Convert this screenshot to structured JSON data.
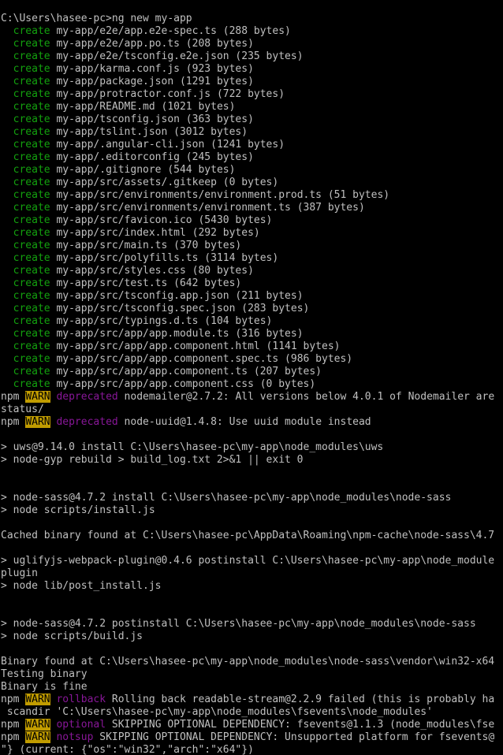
{
  "colors": {
    "background": "#000000",
    "foreground": "#c0c0c0",
    "create_green": "#13a10e",
    "warn_background": "#c19c00",
    "warn_text": "#000000",
    "magenta": "#881798"
  },
  "lines": [
    [
      {
        "t": "C:\\Users\\hasee-pc>ng new my-app",
        "c": "gray"
      }
    ],
    [
      {
        "t": "  create",
        "c": "green"
      },
      {
        "t": " my-app/e2e/app.e2e-spec.ts (288 bytes)",
        "c": "gray"
      }
    ],
    [
      {
        "t": "  create",
        "c": "green"
      },
      {
        "t": " my-app/e2e/app.po.ts (208 bytes)",
        "c": "gray"
      }
    ],
    [
      {
        "t": "  create",
        "c": "green"
      },
      {
        "t": " my-app/e2e/tsconfig.e2e.json (235 bytes)",
        "c": "gray"
      }
    ],
    [
      {
        "t": "  create",
        "c": "green"
      },
      {
        "t": " my-app/karma.conf.js (923 bytes)",
        "c": "gray"
      }
    ],
    [
      {
        "t": "  create",
        "c": "green"
      },
      {
        "t": " my-app/package.json (1291 bytes)",
        "c": "gray"
      }
    ],
    [
      {
        "t": "  create",
        "c": "green"
      },
      {
        "t": " my-app/protractor.conf.js (722 bytes)",
        "c": "gray"
      }
    ],
    [
      {
        "t": "  create",
        "c": "green"
      },
      {
        "t": " my-app/README.md (1021 bytes)",
        "c": "gray"
      }
    ],
    [
      {
        "t": "  create",
        "c": "green"
      },
      {
        "t": " my-app/tsconfig.json (363 bytes)",
        "c": "gray"
      }
    ],
    [
      {
        "t": "  create",
        "c": "green"
      },
      {
        "t": " my-app/tslint.json (3012 bytes)",
        "c": "gray"
      }
    ],
    [
      {
        "t": "  create",
        "c": "green"
      },
      {
        "t": " my-app/.angular-cli.json (1241 bytes)",
        "c": "gray"
      }
    ],
    [
      {
        "t": "  create",
        "c": "green"
      },
      {
        "t": " my-app/.editorconfig (245 bytes)",
        "c": "gray"
      }
    ],
    [
      {
        "t": "  create",
        "c": "green"
      },
      {
        "t": " my-app/.gitignore (544 bytes)",
        "c": "gray"
      }
    ],
    [
      {
        "t": "  create",
        "c": "green"
      },
      {
        "t": " my-app/src/assets/.gitkeep (0 bytes)",
        "c": "gray"
      }
    ],
    [
      {
        "t": "  create",
        "c": "green"
      },
      {
        "t": " my-app/src/environments/environment.prod.ts (51 bytes)",
        "c": "gray"
      }
    ],
    [
      {
        "t": "  create",
        "c": "green"
      },
      {
        "t": " my-app/src/environments/environment.ts (387 bytes)",
        "c": "gray"
      }
    ],
    [
      {
        "t": "  create",
        "c": "green"
      },
      {
        "t": " my-app/src/favicon.ico (5430 bytes)",
        "c": "gray"
      }
    ],
    [
      {
        "t": "  create",
        "c": "green"
      },
      {
        "t": " my-app/src/index.html (292 bytes)",
        "c": "gray"
      }
    ],
    [
      {
        "t": "  create",
        "c": "green"
      },
      {
        "t": " my-app/src/main.ts (370 bytes)",
        "c": "gray"
      }
    ],
    [
      {
        "t": "  create",
        "c": "green"
      },
      {
        "t": " my-app/src/polyfills.ts (3114 bytes)",
        "c": "gray"
      }
    ],
    [
      {
        "t": "  create",
        "c": "green"
      },
      {
        "t": " my-app/src/styles.css (80 bytes)",
        "c": "gray"
      }
    ],
    [
      {
        "t": "  create",
        "c": "green"
      },
      {
        "t": " my-app/src/test.ts (642 bytes)",
        "c": "gray"
      }
    ],
    [
      {
        "t": "  create",
        "c": "green"
      },
      {
        "t": " my-app/src/tsconfig.app.json (211 bytes)",
        "c": "gray"
      }
    ],
    [
      {
        "t": "  create",
        "c": "green"
      },
      {
        "t": " my-app/src/tsconfig.spec.json (283 bytes)",
        "c": "gray"
      }
    ],
    [
      {
        "t": "  create",
        "c": "green"
      },
      {
        "t": " my-app/src/typings.d.ts (104 bytes)",
        "c": "gray"
      }
    ],
    [
      {
        "t": "  create",
        "c": "green"
      },
      {
        "t": " my-app/src/app/app.module.ts (316 bytes)",
        "c": "gray"
      }
    ],
    [
      {
        "t": "  create",
        "c": "green"
      },
      {
        "t": " my-app/src/app/app.component.html (1141 bytes)",
        "c": "gray"
      }
    ],
    [
      {
        "t": "  create",
        "c": "green"
      },
      {
        "t": " my-app/src/app/app.component.spec.ts (986 bytes)",
        "c": "gray"
      }
    ],
    [
      {
        "t": "  create",
        "c": "green"
      },
      {
        "t": " my-app/src/app/app.component.ts (207 bytes)",
        "c": "gray"
      }
    ],
    [
      {
        "t": "  create",
        "c": "green"
      },
      {
        "t": " my-app/src/app/app.component.css (0 bytes)",
        "c": "gray"
      }
    ],
    [
      {
        "t": "npm ",
        "c": "gray"
      },
      {
        "t": "WARN",
        "c": "warn"
      },
      {
        "t": " ",
        "c": "gray"
      },
      {
        "t": "deprecated",
        "c": "magenta"
      },
      {
        "t": " nodemailer@2.7.2: All versions below 4.0.1 of Nodemailer are",
        "c": "gray"
      }
    ],
    [
      {
        "t": "status/",
        "c": "gray"
      }
    ],
    [
      {
        "t": "npm ",
        "c": "gray"
      },
      {
        "t": "WARN",
        "c": "warn"
      },
      {
        "t": " ",
        "c": "gray"
      },
      {
        "t": "deprecated",
        "c": "magenta"
      },
      {
        "t": " node-uuid@1.4.8: Use uuid module instead",
        "c": "gray"
      }
    ],
    [
      {
        "t": "",
        "c": "gray"
      }
    ],
    [
      {
        "t": "> uws@9.14.0 install C:\\Users\\hasee-pc\\my-app\\node_modules\\uws",
        "c": "gray"
      }
    ],
    [
      {
        "t": "> node-gyp rebuild > build_log.txt 2>&1 || exit 0",
        "c": "gray"
      }
    ],
    [
      {
        "t": "",
        "c": "gray"
      }
    ],
    [
      {
        "t": "",
        "c": "gray"
      }
    ],
    [
      {
        "t": "> node-sass@4.7.2 install C:\\Users\\hasee-pc\\my-app\\node_modules\\node-sass",
        "c": "gray"
      }
    ],
    [
      {
        "t": "> node scripts/install.js",
        "c": "gray"
      }
    ],
    [
      {
        "t": "",
        "c": "gray"
      }
    ],
    [
      {
        "t": "Cached binary found at C:\\Users\\hasee-pc\\AppData\\Roaming\\npm-cache\\node-sass\\4.7",
        "c": "gray"
      }
    ],
    [
      {
        "t": "",
        "c": "gray"
      }
    ],
    [
      {
        "t": "> uglifyjs-webpack-plugin@0.4.6 postinstall C:\\Users\\hasee-pc\\my-app\\node_module",
        "c": "gray"
      }
    ],
    [
      {
        "t": "plugin",
        "c": "gray"
      }
    ],
    [
      {
        "t": "> node lib/post_install.js",
        "c": "gray"
      }
    ],
    [
      {
        "t": "",
        "c": "gray"
      }
    ],
    [
      {
        "t": "",
        "c": "gray"
      }
    ],
    [
      {
        "t": "> node-sass@4.7.2 postinstall C:\\Users\\hasee-pc\\my-app\\node_modules\\node-sass",
        "c": "gray"
      }
    ],
    [
      {
        "t": "> node scripts/build.js",
        "c": "gray"
      }
    ],
    [
      {
        "t": "",
        "c": "gray"
      }
    ],
    [
      {
        "t": "Binary found at C:\\Users\\hasee-pc\\my-app\\node_modules\\node-sass\\vendor\\win32-x64",
        "c": "gray"
      }
    ],
    [
      {
        "t": "Testing binary",
        "c": "gray"
      }
    ],
    [
      {
        "t": "Binary is fine",
        "c": "gray"
      }
    ],
    [
      {
        "t": "npm ",
        "c": "gray"
      },
      {
        "t": "WARN",
        "c": "warn"
      },
      {
        "t": " ",
        "c": "gray"
      },
      {
        "t": "rollback",
        "c": "magenta"
      },
      {
        "t": " Rolling back readable-stream@2.2.9 failed (this is probably ha",
        "c": "gray"
      }
    ],
    [
      {
        "t": " scandir 'C:\\Users\\hasee-pc\\my-app\\node_modules\\fsevents\\node_modules'",
        "c": "gray"
      }
    ],
    [
      {
        "t": "npm ",
        "c": "gray"
      },
      {
        "t": "WARN",
        "c": "warn"
      },
      {
        "t": " ",
        "c": "gray"
      },
      {
        "t": "optional",
        "c": "magenta"
      },
      {
        "t": " SKIPPING OPTIONAL DEPENDENCY: fsevents@1.1.3 (node_modules\\fse",
        "c": "gray"
      }
    ],
    [
      {
        "t": "npm ",
        "c": "gray"
      },
      {
        "t": "WARN",
        "c": "warn"
      },
      {
        "t": " ",
        "c": "gray"
      },
      {
        "t": "notsup",
        "c": "magenta"
      },
      {
        "t": " SKIPPING OPTIONAL DEPENDENCY: Unsupported platform for fsevents@",
        "c": "gray"
      }
    ],
    [
      {
        "t": "\"} (current: {\"os\":\"win32\",\"arch\":\"x64\"})",
        "c": "gray"
      }
    ]
  ]
}
